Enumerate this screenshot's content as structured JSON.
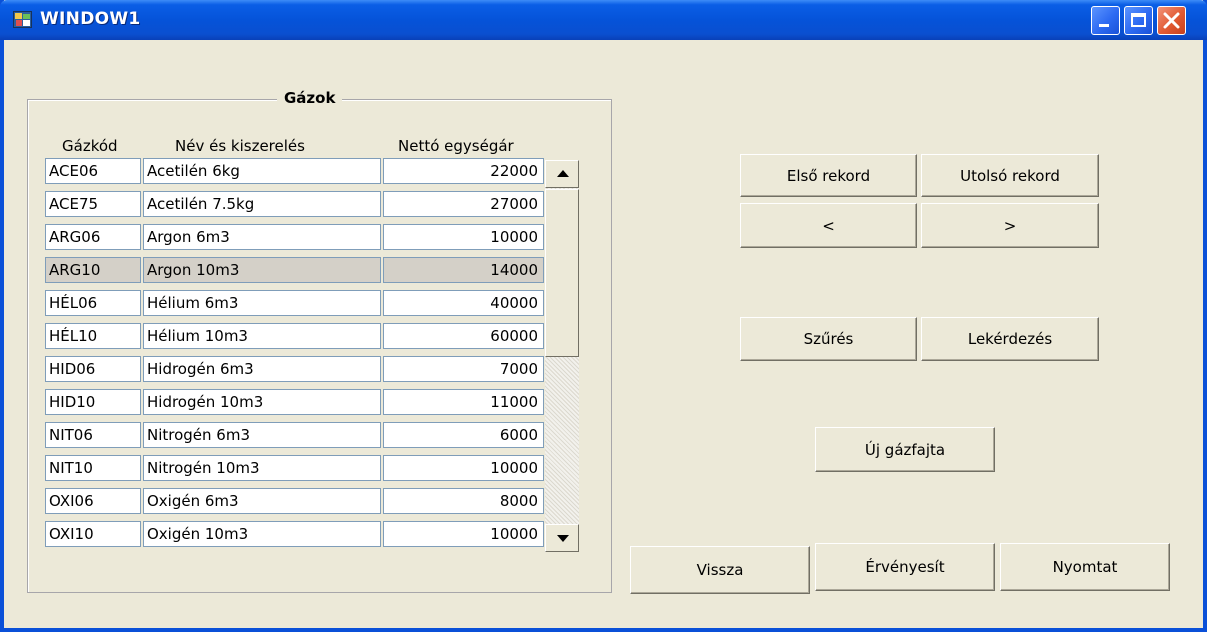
{
  "window": {
    "title": "WINDOW1"
  },
  "group": {
    "title": "Gázok",
    "columns": {
      "code": "Gázkód",
      "name": "Név és kiszerelés",
      "price": "Nettó egységár"
    },
    "rows": [
      {
        "code": "ACE06",
        "name": "Acetilén 6kg",
        "price": "22000"
      },
      {
        "code": "ACE75",
        "name": "Acetilén 7.5kg",
        "price": "27000"
      },
      {
        "code": "ARG06",
        "name": "Argon 6m3",
        "price": "10000"
      },
      {
        "code": "ARG10",
        "name": "Argon 10m3",
        "price": "14000"
      },
      {
        "code": "HÉL06",
        "name": "Hélium 6m3",
        "price": "40000"
      },
      {
        "code": "HÉL10",
        "name": "Hélium 10m3",
        "price": "60000"
      },
      {
        "code": "HID06",
        "name": "Hidrogén 6m3",
        "price": "7000"
      },
      {
        "code": "HID10",
        "name": "Hidrogén 10m3",
        "price": "11000"
      },
      {
        "code": "NIT06",
        "name": "Nitrogén 6m3",
        "price": "6000"
      },
      {
        "code": "NIT10",
        "name": "Nitrogén 10m3",
        "price": "10000"
      },
      {
        "code": "OXI06",
        "name": "Oxigén 6m3",
        "price": "8000"
      },
      {
        "code": "OXI10",
        "name": "Oxigén 10m3",
        "price": "10000"
      }
    ],
    "selected_row": "ARG10"
  },
  "buttons": {
    "first": "Első rekord",
    "last": "Utolsó rekord",
    "prev": "<",
    "next": ">",
    "filter": "Szűrés",
    "query": "Lekérdezés",
    "new_gas": "Új gázfajta",
    "back": "Vissza",
    "apply": "Érvényesít",
    "print": "Nyomtat"
  },
  "icons": {
    "app": "app-icon",
    "minimize": "minimize-icon",
    "maximize": "maximize-icon",
    "close": "close-icon",
    "scroll_up": "scroll-up-arrow-icon",
    "scroll_down": "scroll-down-arrow-icon"
  },
  "colors": {
    "titlebar": "#0553d9",
    "window_bg": "#ece9d8",
    "close_button": "#e15a33",
    "selected_row": "#d4d0c8"
  }
}
